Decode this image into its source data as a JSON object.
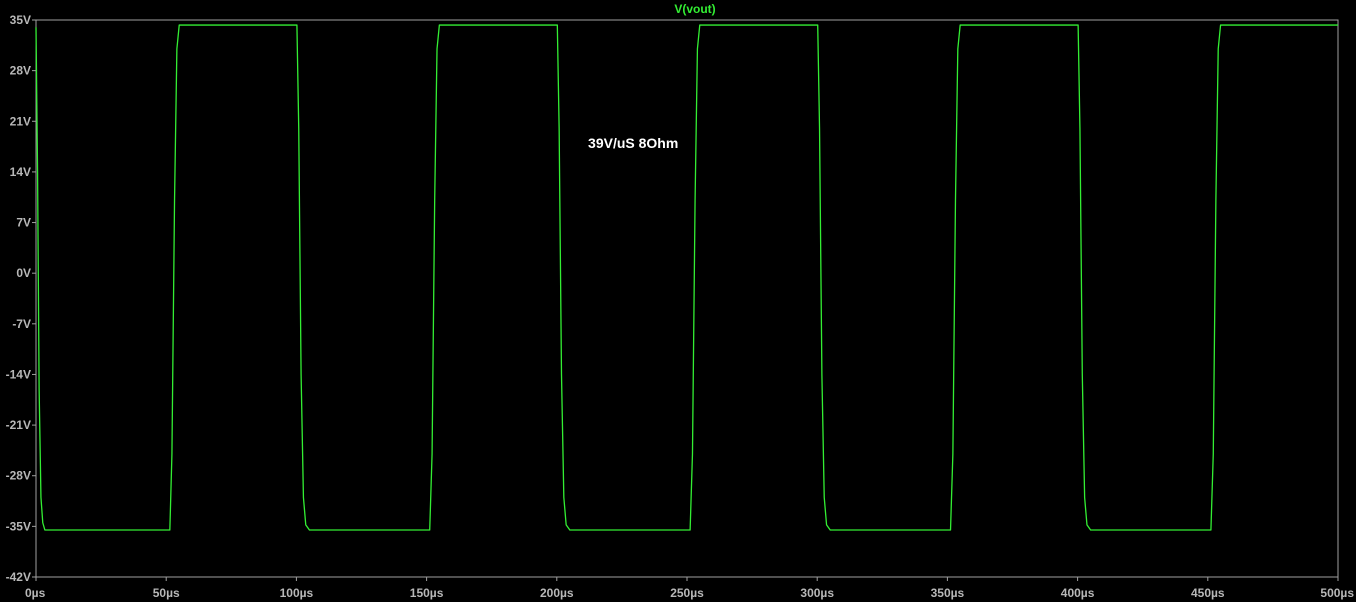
{
  "chart_data": {
    "type": "line",
    "title": "V(vout)",
    "xlabel": "",
    "ylabel": "",
    "xlim": [
      0,
      500
    ],
    "ylim": [
      -42,
      35
    ],
    "x_ticks": [
      0,
      50,
      100,
      150,
      200,
      250,
      300,
      350,
      400,
      450,
      500
    ],
    "x_tick_labels": [
      "0µs",
      "50µs",
      "100µs",
      "150µs",
      "200µs",
      "250µs",
      "300µs",
      "350µs",
      "400µs",
      "450µs",
      "500µs"
    ],
    "y_ticks": [
      35,
      28,
      21,
      14,
      7,
      0,
      -7,
      -14,
      -21,
      -28,
      -35,
      -42
    ],
    "y_tick_labels": [
      "35V",
      "28V",
      "21V",
      "14V",
      "7V",
      "0V",
      "-7V",
      "-14V",
      "-21V",
      "-28V",
      "-35V",
      "-42V"
    ],
    "grid": false,
    "annotations": [
      {
        "text": "39V/uS 8Ohm",
        "x": 212,
        "y": 18
      }
    ],
    "series": [
      {
        "name": "V(vout)",
        "color": "#33ee33",
        "x": [
          0,
          0.6,
          1.2,
          1.9,
          2.6,
          3.4,
          5,
          51.4,
          52.2,
          53.2,
          54.1,
          55,
          56.5,
          100.2,
          100.9,
          101.8,
          102.7,
          103.6,
          105,
          151.2,
          152.1,
          153.1,
          154,
          154.9,
          156.5,
          200.2,
          200.9,
          201.8,
          202.7,
          203.6,
          205,
          251.2,
          252.1,
          253.1,
          254,
          254.9,
          256.5,
          300.2,
          300.9,
          301.8,
          302.7,
          303.6,
          305,
          351.2,
          352.1,
          353.1,
          354,
          354.9,
          356.5,
          400.2,
          400.9,
          401.8,
          402.7,
          403.6,
          405,
          451.2,
          452.1,
          453.1,
          454,
          454.9,
          456.5,
          500
        ],
        "y": [
          34,
          14,
          -16,
          -31,
          -34.5,
          -35.5,
          -35.5,
          -35.5,
          -25,
          10,
          31,
          34.3,
          34.3,
          34.3,
          20,
          -14,
          -31,
          -34.8,
          -35.5,
          -35.5,
          -25,
          10,
          31,
          34.3,
          34.3,
          34.3,
          20,
          -14,
          -31,
          -34.8,
          -35.5,
          -35.5,
          -25,
          10,
          31,
          34.3,
          34.3,
          34.3,
          20,
          -14,
          -31,
          -34.8,
          -35.5,
          -35.5,
          -25,
          10,
          31,
          34.3,
          34.3,
          34.3,
          20,
          -14,
          -31,
          -34.8,
          -35.5,
          -35.5,
          -25,
          10,
          31,
          34.3,
          34.3,
          34.3
        ]
      }
    ]
  },
  "colors": {
    "background": "#000000",
    "axis": "#a0a0a0",
    "tick_label": "#b8b8b8",
    "trace": "#33ee33",
    "annotation": "#ffffff"
  }
}
